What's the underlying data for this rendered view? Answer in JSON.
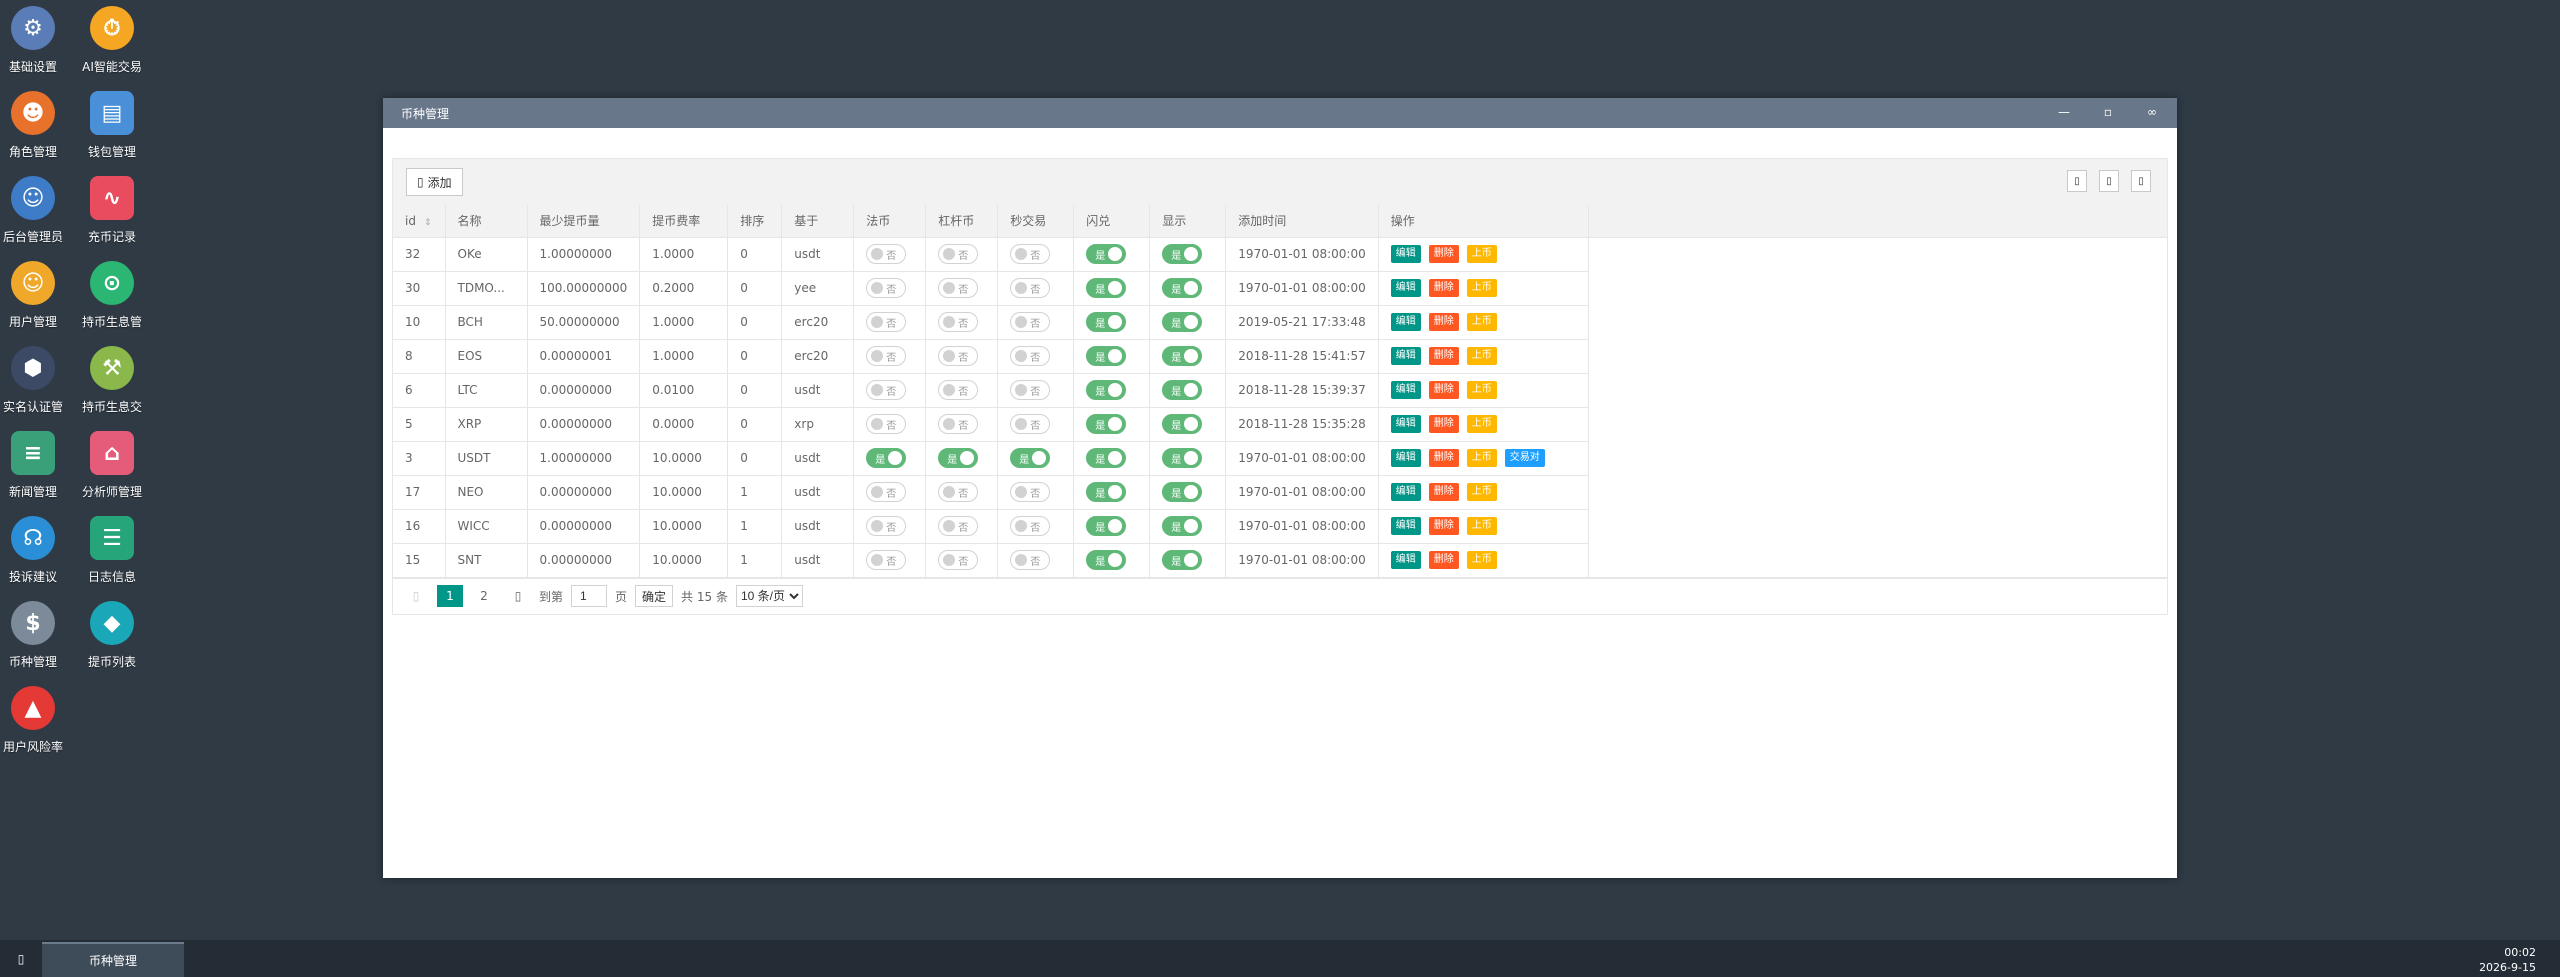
{
  "desktop": {
    "icons": [
      {
        "label": "基础设置",
        "icon": "gear-icon",
        "color": "#5b7db7"
      },
      {
        "label": "AI智能交易",
        "icon": "stopwatch-icon",
        "color": "#f5a623"
      },
      {
        "label": "角色管理",
        "icon": "role-icon",
        "color": "#e8722c"
      },
      {
        "label": "钱包管理",
        "icon": "wallet-icon",
        "color": "#4a90d9"
      },
      {
        "label": "后台管理员",
        "icon": "admin-icon",
        "color": "#3f7cc8"
      },
      {
        "label": "充币记录",
        "icon": "chart-icon",
        "color": "#e84c5e"
      },
      {
        "label": "用户管理",
        "icon": "user-icon",
        "color": "#f0a82a"
      },
      {
        "label": "持币生息管",
        "icon": "lock-icon",
        "color": "#2bb673"
      },
      {
        "label": "实名认证管",
        "icon": "shield-icon",
        "color": "#3c4a66"
      },
      {
        "label": "持币生息交",
        "icon": "hammer-icon",
        "color": "#8bb84a"
      },
      {
        "label": "新闻管理",
        "icon": "document-icon",
        "color": "#3aa07a"
      },
      {
        "label": "分析师管理",
        "icon": "store-icon",
        "color": "#e55b7a"
      },
      {
        "label": "投诉建议",
        "icon": "headset-icon",
        "color": "#2a8fd6"
      },
      {
        "label": "日志信息",
        "icon": "log-icon",
        "color": "#27a57a"
      },
      {
        "label": "币种管理",
        "icon": "dollar-icon",
        "color": "#7d8a99"
      },
      {
        "label": "提币列表",
        "icon": "coin-list-icon",
        "color": "#1aa8b8"
      },
      {
        "label": "用户风险率",
        "icon": "alarm-icon",
        "color": "#e53935"
      }
    ]
  },
  "window": {
    "title": "币种管理",
    "toolbar": {
      "add_label": "添加"
    },
    "table": {
      "headers": [
        "id",
        "名称",
        "最少提币量",
        "提币费率",
        "排序",
        "基于",
        "法币",
        "杠杆币",
        "秒交易",
        "闪兑",
        "显示",
        "添加时间",
        "操作"
      ],
      "on_label": "是",
      "off_label": "否",
      "ops": {
        "edit": "编辑",
        "delete": "删除",
        "list": "上币",
        "pair": "交易对"
      },
      "rows": [
        {
          "id": "32",
          "name": "OKe",
          "min": "1.00000000",
          "fee": "1.0000",
          "sort": "0",
          "base": "usdt",
          "fiat": false,
          "lever": false,
          "sec": false,
          "flash": true,
          "show": true,
          "time": "1970-01-01 08:00:00",
          "pair": false
        },
        {
          "id": "30",
          "name": "TDMO...",
          "min": "100.00000000",
          "fee": "0.2000",
          "sort": "0",
          "base": "yee",
          "fiat": false,
          "lever": false,
          "sec": false,
          "flash": true,
          "show": true,
          "time": "1970-01-01 08:00:00",
          "pair": false
        },
        {
          "id": "10",
          "name": "BCH",
          "min": "50.00000000",
          "fee": "1.0000",
          "sort": "0",
          "base": "erc20",
          "fiat": false,
          "lever": false,
          "sec": false,
          "flash": true,
          "show": true,
          "time": "2019-05-21 17:33:48",
          "pair": false
        },
        {
          "id": "8",
          "name": "EOS",
          "min": "0.00000001",
          "fee": "1.0000",
          "sort": "0",
          "base": "erc20",
          "fiat": false,
          "lever": false,
          "sec": false,
          "flash": true,
          "show": true,
          "time": "2018-11-28 15:41:57",
          "pair": false
        },
        {
          "id": "6",
          "name": "LTC",
          "min": "0.00000000",
          "fee": "0.0100",
          "sort": "0",
          "base": "usdt",
          "fiat": false,
          "lever": false,
          "sec": false,
          "flash": true,
          "show": true,
          "time": "2018-11-28 15:39:37",
          "pair": false
        },
        {
          "id": "5",
          "name": "XRP",
          "min": "0.00000000",
          "fee": "0.0000",
          "sort": "0",
          "base": "xrp",
          "fiat": false,
          "lever": false,
          "sec": false,
          "flash": true,
          "show": true,
          "time": "2018-11-28 15:35:28",
          "pair": false
        },
        {
          "id": "3",
          "name": "USDT",
          "min": "1.00000000",
          "fee": "10.0000",
          "sort": "0",
          "base": "usdt",
          "fiat": true,
          "lever": true,
          "sec": true,
          "flash": true,
          "show": true,
          "time": "1970-01-01 08:00:00",
          "pair": true
        },
        {
          "id": "17",
          "name": "NEO",
          "min": "0.00000000",
          "fee": "10.0000",
          "sort": "1",
          "base": "usdt",
          "fiat": false,
          "lever": false,
          "sec": false,
          "flash": true,
          "show": true,
          "time": "1970-01-01 08:00:00",
          "pair": false
        },
        {
          "id": "16",
          "name": "WICC",
          "min": "0.00000000",
          "fee": "10.0000",
          "sort": "1",
          "base": "usdt",
          "fiat": false,
          "lever": false,
          "sec": false,
          "flash": true,
          "show": true,
          "time": "1970-01-01 08:00:00",
          "pair": false
        },
        {
          "id": "15",
          "name": "SNT",
          "min": "0.00000000",
          "fee": "10.0000",
          "sort": "1",
          "base": "usdt",
          "fiat": false,
          "lever": false,
          "sec": false,
          "flash": true,
          "show": true,
          "time": "1970-01-01 08:00:00",
          "pair": false
        }
      ]
    },
    "pager": {
      "pages": [
        "1",
        "2"
      ],
      "current": "1",
      "goto_label": "到第",
      "page_input": "1",
      "page_unit": "页",
      "confirm": "确定",
      "total": "共 15 条",
      "page_size": "10 条/页"
    }
  },
  "taskbar": {
    "tab": "币种管理",
    "time": "00:02",
    "date": "2026-9-15"
  }
}
